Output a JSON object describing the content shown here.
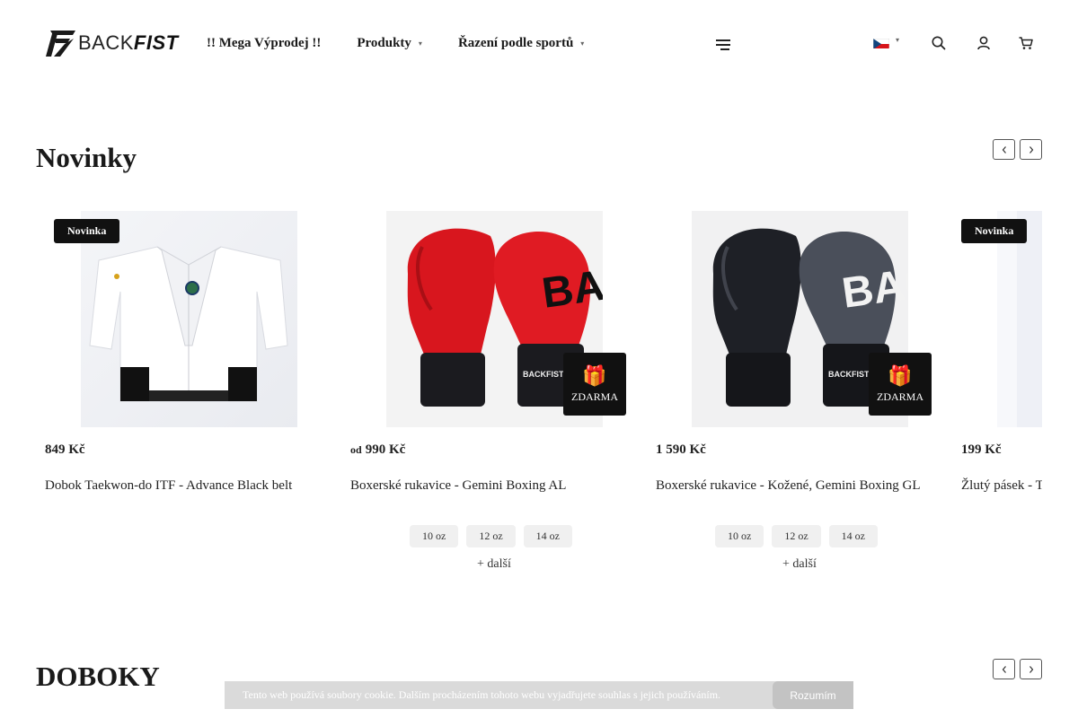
{
  "header": {
    "logo": {
      "back": "BACK",
      "fist": "FIST"
    },
    "nav": [
      {
        "label": "!! Mega Výprodej !!",
        "has_dropdown": false
      },
      {
        "label": "Produkty",
        "has_dropdown": true
      },
      {
        "label": "Řazení podle sportů",
        "has_dropdown": true
      }
    ],
    "icons": [
      "menu-icon",
      "czech-flag-icon",
      "search-icon",
      "user-icon",
      "cart-icon"
    ]
  },
  "sections": {
    "novinky": {
      "title": "Novinky"
    },
    "doboky": {
      "title": "DOBOKY"
    }
  },
  "products": [
    {
      "badge": "Novinka",
      "price_prefix": "",
      "price": "849 Kč",
      "name": "Dobok Taekwon-do ITF - Advance Black belt",
      "sizes": [],
      "free_label": "",
      "more_label": ""
    },
    {
      "badge": "",
      "price_prefix": "od",
      "price": "990 Kč",
      "name": "Boxerské rukavice - Gemini Boxing AL",
      "sizes": [
        "10 oz",
        "12 oz",
        "14 oz"
      ],
      "free_label": "ZDARMA",
      "more_label": "+ další"
    },
    {
      "badge": "",
      "price_prefix": "",
      "price": "1 590 Kč",
      "name": "Boxerské rukavice - Kožené, Gemini Boxing GL",
      "sizes": [
        "10 oz",
        "12 oz",
        "14 oz"
      ],
      "free_label": "ZDARMA",
      "more_label": "+ další"
    },
    {
      "badge": "Novinka",
      "price_prefix": "",
      "price": "199 Kč",
      "name": "Žlutý pásek - Taekwon-do ITF",
      "sizes": [],
      "free_label": "",
      "more_label": ""
    }
  ],
  "cookie_bar": {
    "text": "Tento web používá soubory cookie. Dalším procházením tohoto webu vyjadřujete souhlas s jejich používáním.",
    "button": "Rozumím"
  },
  "colors": {
    "text": "#1a1a1a",
    "badge_bg": "#111111",
    "glove_red": "#d6161e",
    "glove_black": "#1b1b1f",
    "cookie_bg": "#d7d7d7"
  }
}
